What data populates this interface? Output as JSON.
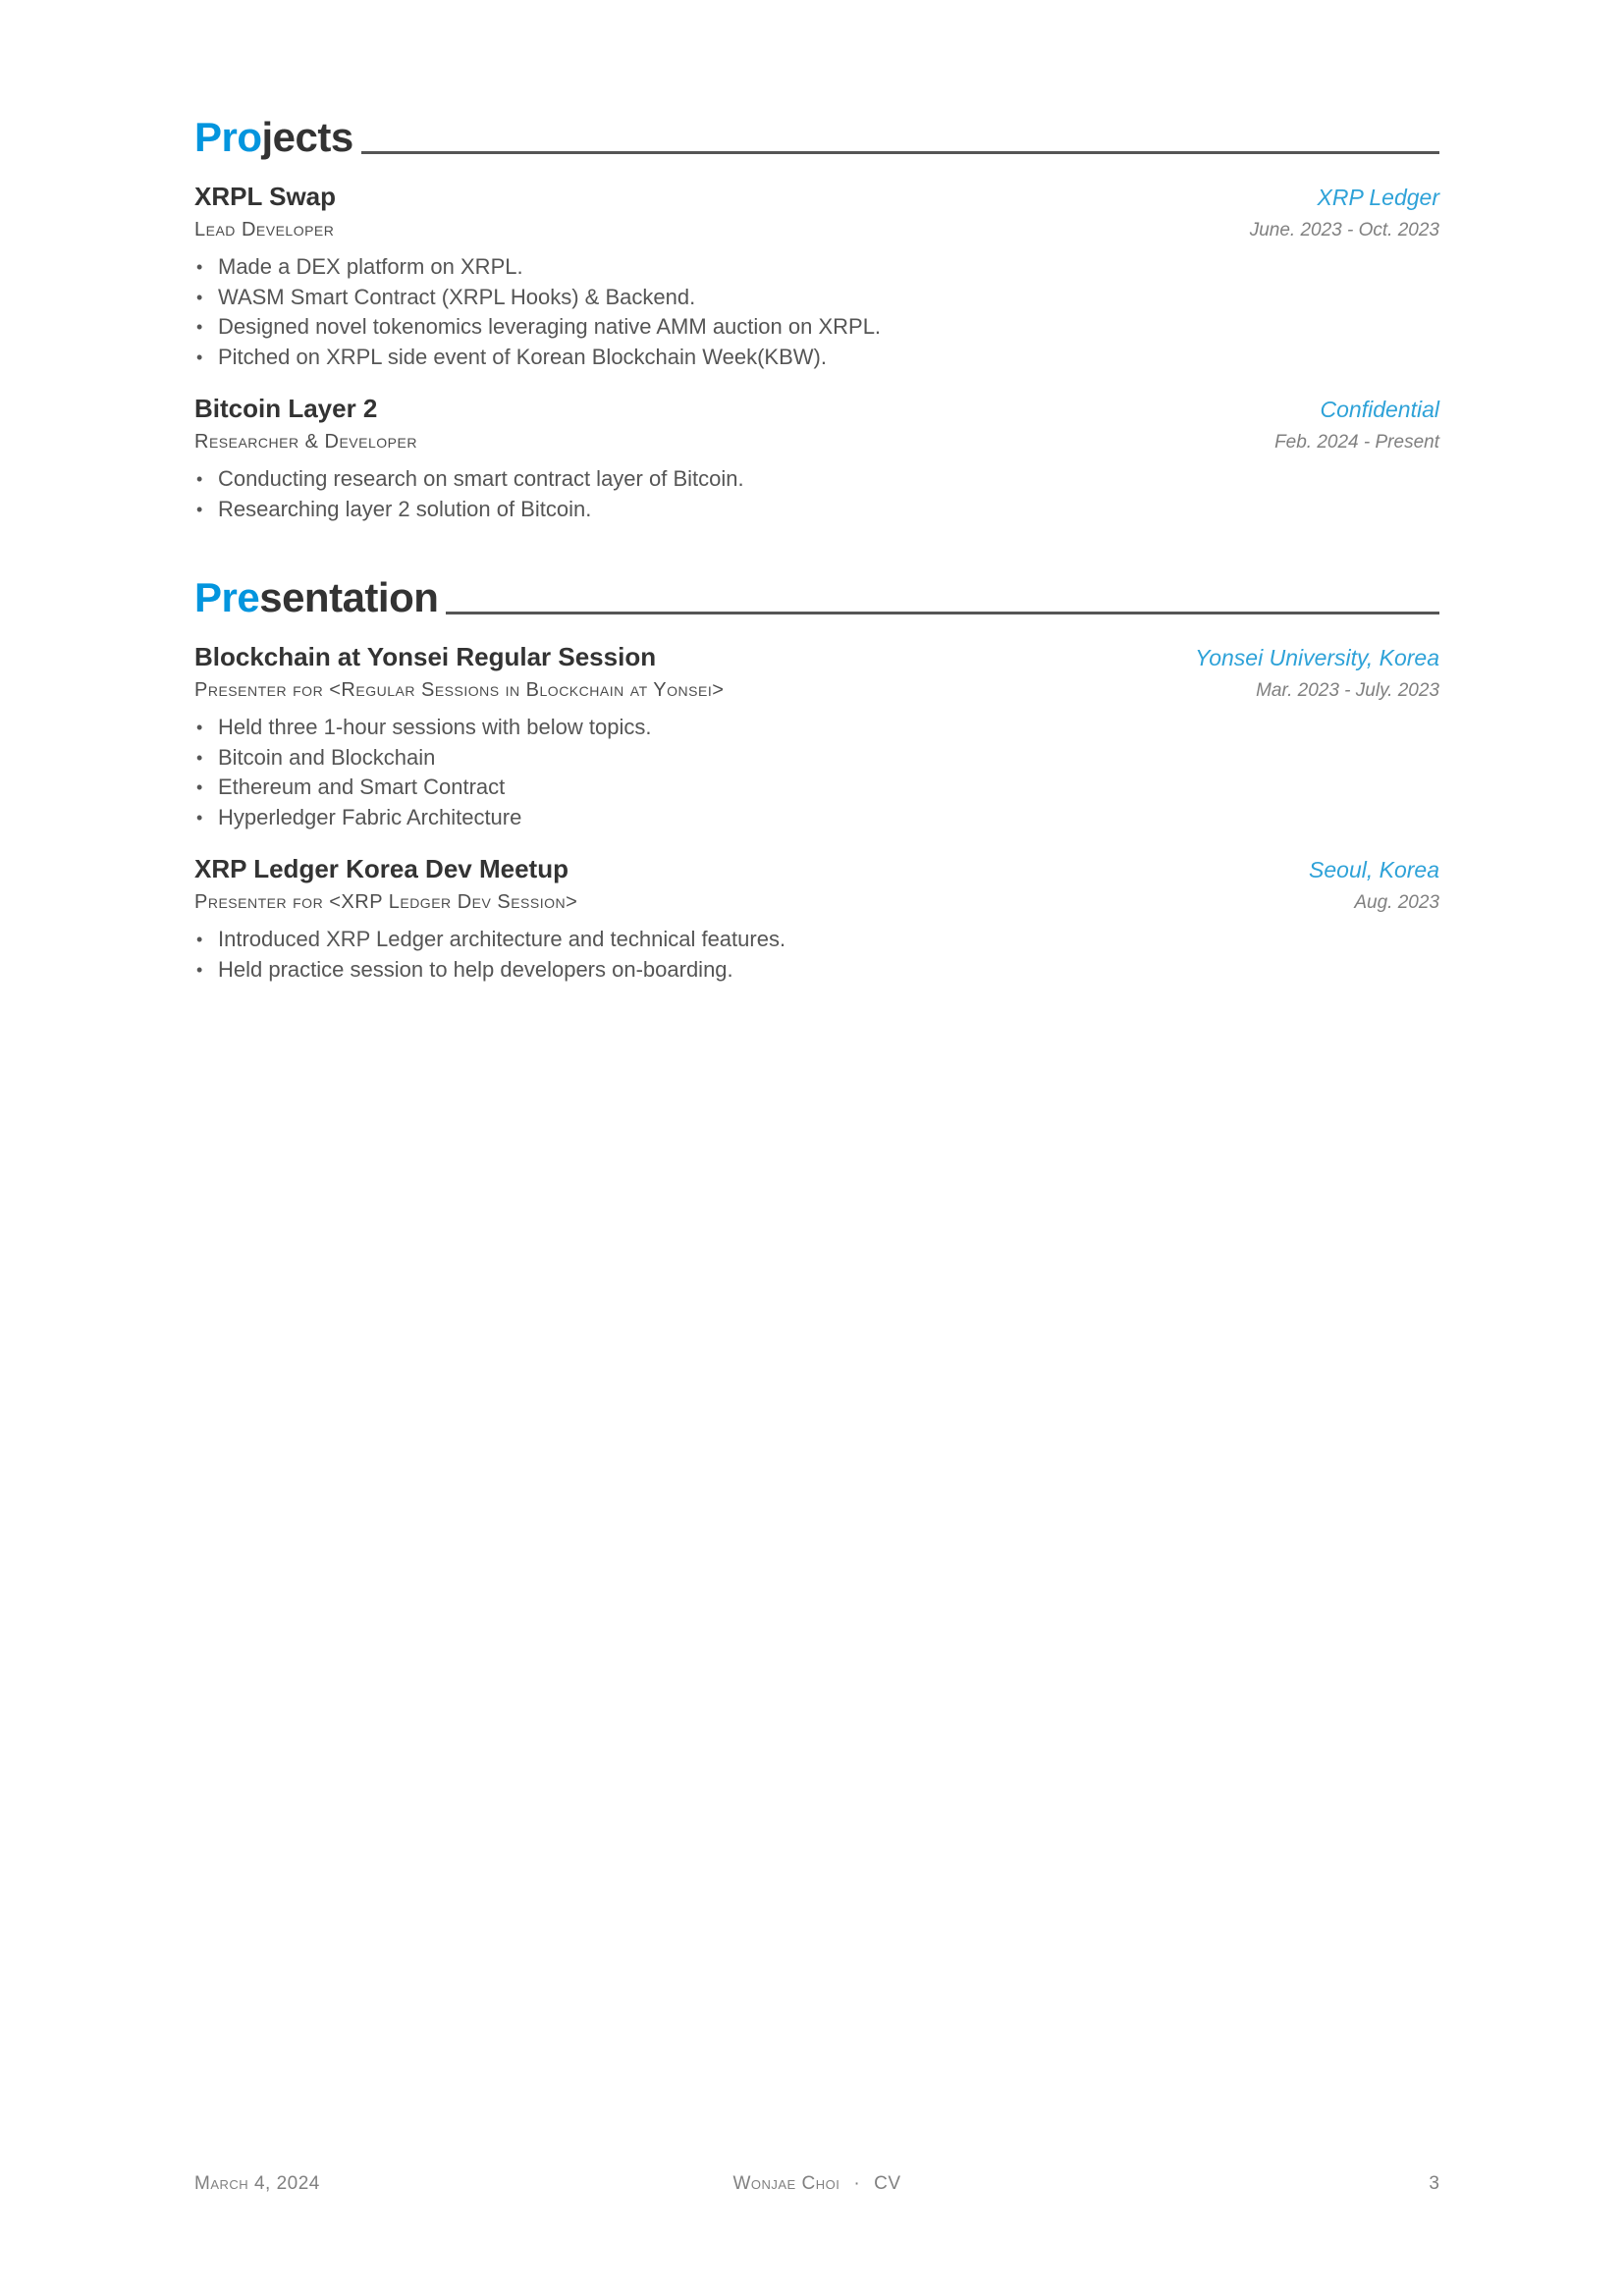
{
  "sections": [
    {
      "title_accent": "Pro",
      "title_rest": "jects",
      "entries": [
        {
          "title": "XRPL Swap",
          "location": "XRP Ledger",
          "position": "Lead Developer",
          "date": "June. 2023 - Oct. 2023",
          "bullets": [
            "Made a DEX platform on XRPL.",
            "WASM Smart Contract (XRPL Hooks) & Backend.",
            "Designed novel tokenomics leveraging native AMM auction on XRPL.",
            "Pitched on XRPL side event of Korean Blockchain Week(KBW)."
          ]
        },
        {
          "title": "Bitcoin Layer 2",
          "location": "Confidential",
          "position": "Researcher & Developer",
          "date": "Feb. 2024 - Present",
          "bullets": [
            "Conducting research on smart contract layer of Bitcoin.",
            "Researching layer 2 solution of Bitcoin."
          ]
        }
      ]
    },
    {
      "title_accent": "Pre",
      "title_rest": "sentation",
      "entries": [
        {
          "title": "Blockchain at Yonsei Regular Session",
          "location": "Yonsei University, Korea",
          "position": "Presenter for <Regular Sessions in Blockchain at Yonsei>",
          "date": "Mar. 2023 - July. 2023",
          "bullets": [
            "Held three 1-hour sessions with below topics.",
            "Bitcoin and Blockchain",
            "Ethereum and Smart Contract",
            "Hyperledger Fabric Architecture"
          ]
        },
        {
          "title": "XRP Ledger Korea Dev Meetup",
          "location": "Seoul, Korea",
          "position": "Presenter for <XRP Ledger Dev Session>",
          "date": "Aug. 2023",
          "bullets": [
            "Introduced XRP Ledger architecture and technical features.",
            "Held practice session to help developers on-boarding."
          ]
        }
      ]
    }
  ],
  "footer": {
    "date": "March 4, 2024",
    "name": "Wonjae Choi",
    "separator": "·",
    "doc": "CV",
    "page": "3"
  },
  "colors": {
    "accent": "#0395de",
    "location": "#2ea2d8",
    "text": "#333333",
    "muted": "#808080"
  }
}
